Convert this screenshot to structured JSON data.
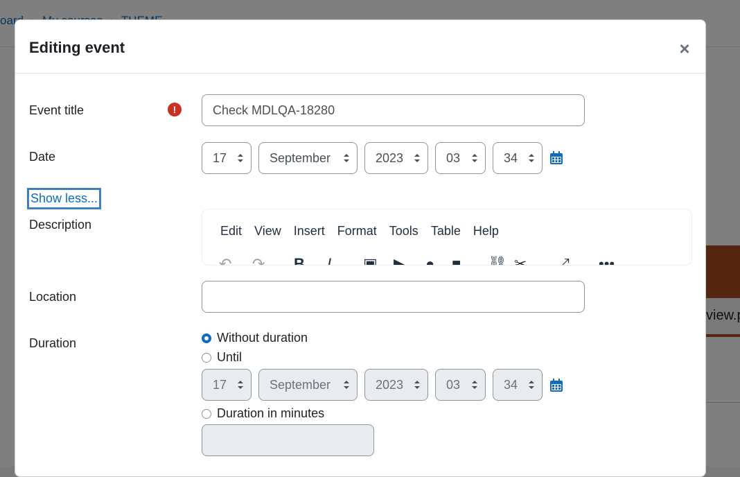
{
  "background": {
    "breadcrumb": [
      "oard",
      "My courses",
      "THEME"
    ],
    "banner_text": "view.p"
  },
  "modal": {
    "title": "Editing event",
    "close_symbol": "×"
  },
  "form": {
    "event_title": {
      "label": "Event title",
      "value": "Check MDLQA-18280",
      "required_icon": "!"
    },
    "date": {
      "label": "Date",
      "day": "17",
      "month": "September",
      "year": "2023",
      "hour": "03",
      "minute": "34"
    },
    "show_less": "Show less...",
    "description": {
      "label": "Description",
      "menu": [
        "Edit",
        "View",
        "Insert",
        "Format",
        "Tools",
        "Table",
        "Help"
      ],
      "toolbar_icons": [
        "undo-icon",
        "redo-icon",
        "bold-icon",
        "italic-icon",
        "image-icon",
        "media-icon",
        "microphone-icon",
        "video-camera-icon",
        "link-icon",
        "unlink-icon",
        "fullscreen-icon",
        "more-icon"
      ]
    },
    "location": {
      "label": "Location",
      "value": ""
    },
    "duration": {
      "label": "Duration",
      "option_without": "Without duration",
      "option_until": "Until",
      "option_minutes": "Duration in minutes",
      "selected": "without",
      "until_day": "17",
      "until_month": "September",
      "until_year": "2023",
      "until_hour": "03",
      "until_minute": "34",
      "minutes_value": ""
    }
  },
  "colors": {
    "accent": "#0f6cbf",
    "error": "#ca3120",
    "text": "#1d2125"
  }
}
